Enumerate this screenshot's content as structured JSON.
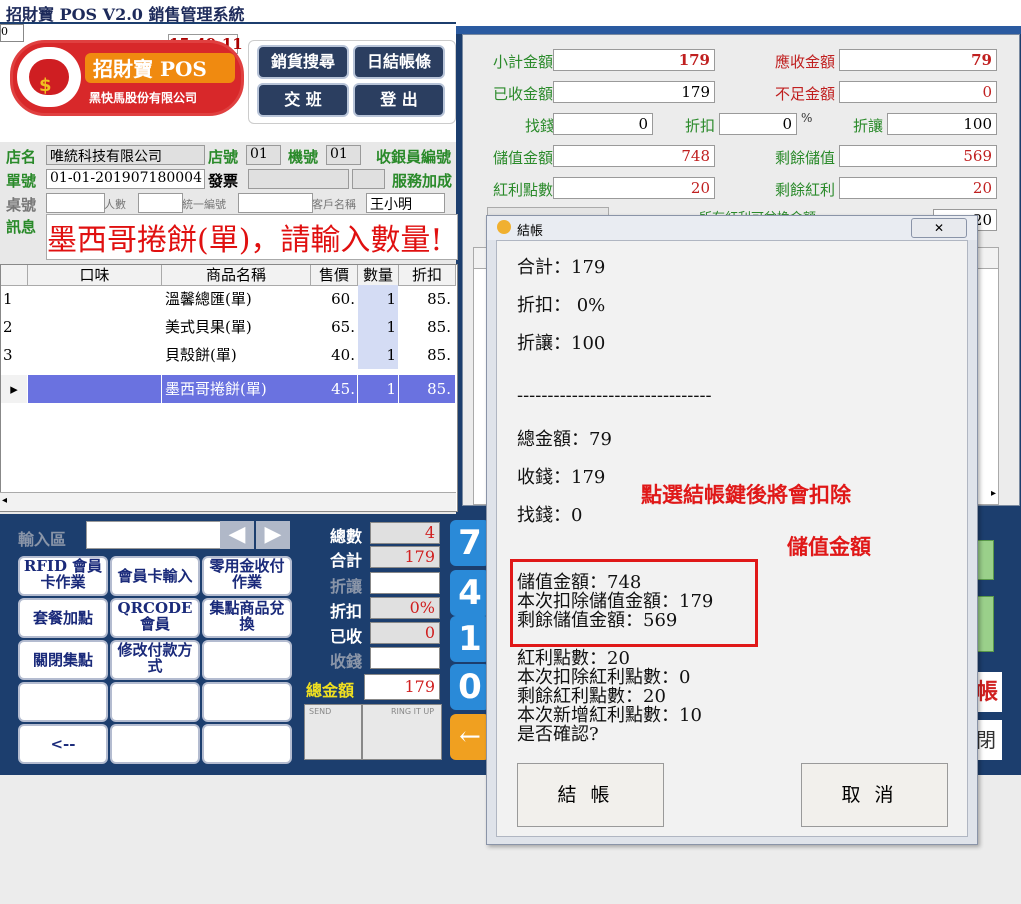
{
  "app": {
    "title": "招財寶 POS V2.0 銷售管理系統",
    "counter": "0",
    "clock": "15:49:11",
    "logo_brand": "招財寶 POS",
    "logo_company": "黑快馬股份有限公司",
    "top_buttons": [
      "銷貨搜尋",
      "日結帳條",
      "交 班",
      "登 出"
    ]
  },
  "header": {
    "store_name_label": "店名",
    "store_name": "唯統科技有限公司",
    "store_no_label": "店號",
    "store_no": "01",
    "machine_no_label": "機號",
    "machine_no": "01",
    "cashier_label": "收銀員編號",
    "order_no_label": "單號",
    "order_no": "01-01-201907180004",
    "invoice_label": "發票",
    "service_label": "服務加成",
    "table_label": "桌號",
    "people_label": "人數",
    "tax_id_label": "統一編號",
    "customer_label": "客戶名稱",
    "customer_name": "王小明",
    "message_label": "訊息",
    "message": "墨西哥捲餅(單)，請輸入數量!"
  },
  "grid": {
    "columns": [
      "口味",
      "商品名稱",
      "售價",
      "數量",
      "折扣"
    ],
    "rows": [
      {
        "no": "1",
        "flavor": "",
        "name": "溫馨總匯(單)",
        "price": "60.",
        "qty": "1",
        "discount": "85."
      },
      {
        "no": "2",
        "flavor": "",
        "name": "美式貝果(單)",
        "price": "65.",
        "qty": "1",
        "discount": "85."
      },
      {
        "no": "3",
        "flavor": "",
        "name": "貝殼餅(單)",
        "price": "40.",
        "qty": "1",
        "discount": "85."
      },
      {
        "no": "▸",
        "flavor": "",
        "name": "墨西哥捲餅(單)",
        "price": "45.",
        "qty": "1",
        "discount": "85."
      }
    ]
  },
  "bottom": {
    "input_label": "輸入區",
    "buttons": [
      "RFID 會員卡作業",
      "會員卡輸入",
      "零用金收付作業",
      "套餐加點",
      "QRCODE會員",
      "集點商品兌換",
      "關閉集點",
      "修改付款方式",
      "",
      "",
      "",
      "",
      "<--",
      "",
      ""
    ],
    "totals": {
      "count_label": "總數",
      "count": "4",
      "subtotal_label": "合計",
      "subtotal": "179",
      "allowance_label": "折讓",
      "allowance": "",
      "discount_label": "折扣",
      "discount": "0%",
      "received_label": "已收",
      "received": "0",
      "paid_label": "收錢",
      "paid": "",
      "total_label": "總金額",
      "total": "179"
    },
    "send_label": "SEND",
    "ring_label": "RING IT UP",
    "num_keys": [
      "7",
      "4",
      "1",
      "0"
    ]
  },
  "right": {
    "subtotal_label": "小計金額",
    "subtotal": "179",
    "receivable_label": "應收金額",
    "receivable": "79",
    "received_label": "已收金額",
    "received": "179",
    "shortfall_label": "不足金額",
    "shortfall": "0",
    "change_label": "找錢",
    "change": "0",
    "discount_label": "折扣",
    "discount": "0",
    "percent": "%",
    "allowance_label": "折讓",
    "allowance": "100",
    "stored_label": "儲值金額",
    "stored": "748",
    "stored_remain_label": "剩餘儲值",
    "stored_remain": "569",
    "bonus_label": "紅利點數",
    "bonus": "20",
    "bonus_remain_label": "剩餘紅利",
    "bonus_remain": "20",
    "partial_value": "20",
    "partial_label": "所有紅利可兌換金額"
  },
  "dialog": {
    "title": "結帳",
    "total": "合計：179",
    "discount": "折扣： 0%",
    "allowance": "折讓：100",
    "separator": "--------------------------------",
    "grand_total": "總金額：79",
    "paid": "收錢：179",
    "change": "找錢：0",
    "stored_value": "儲值金額：748",
    "stored_deduct": "本次扣除儲值金額：179",
    "stored_remain": "剩餘儲值金額：569",
    "bonus": "紅利點數：20",
    "bonus_deduct": "本次扣除紅利點數：0",
    "bonus_remain": "剩餘紅利點數：20",
    "bonus_add": "本次新增紅利點數：10",
    "confirm": "是否確認?",
    "annotation_line1": "點選結帳鍵後將會扣除",
    "annotation_line2": "儲值金額",
    "ok_button": "結帳",
    "cancel_button": "取消",
    "close_icon": "✕"
  },
  "side_fragments": {
    "right_char1": "帳",
    "right_char2": "閉"
  }
}
